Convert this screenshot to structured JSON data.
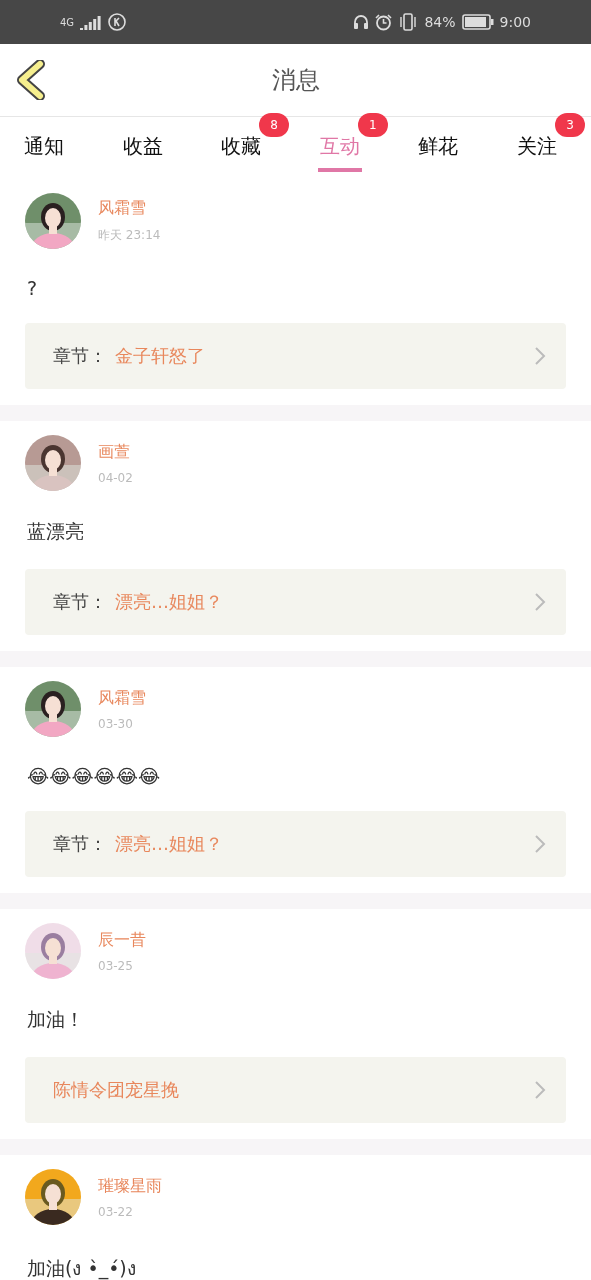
{
  "status_bar": {
    "network": "4G",
    "battery": "84%",
    "time": "9:00"
  },
  "header": {
    "title": "消息"
  },
  "tabs": [
    {
      "label": "通知",
      "selected": false
    },
    {
      "label": "收益",
      "selected": false
    },
    {
      "label": "收藏",
      "selected": false,
      "badge": "8"
    },
    {
      "label": "互动",
      "selected": true,
      "badge": "1"
    },
    {
      "label": "鲜花",
      "selected": false
    },
    {
      "label": "关注",
      "selected": false,
      "badge": "3"
    }
  ],
  "messages": [
    {
      "name": "风霜雪",
      "time": "昨天 23:14",
      "text": "?",
      "link": {
        "label": "章节：",
        "title": "金子轩怒了"
      }
    },
    {
      "name": "画萱",
      "time": "04-02",
      "text": "蓝漂亮",
      "link": {
        "label": "章节：",
        "title": "漂亮…姐姐？"
      }
    },
    {
      "name": "风霜雪",
      "time": "03-30",
      "text": "😂😂😂😂😂😂",
      "link": {
        "label": "章节：",
        "title": "漂亮…姐姐？"
      }
    },
    {
      "name": "辰一昔",
      "time": "03-25",
      "text": "加油！",
      "link": {
        "title": "陈情令团宠星挽"
      }
    },
    {
      "name": "璀璨星雨",
      "time": "03-22",
      "text": "加油(ง •̀_•́)ง"
    }
  ]
}
